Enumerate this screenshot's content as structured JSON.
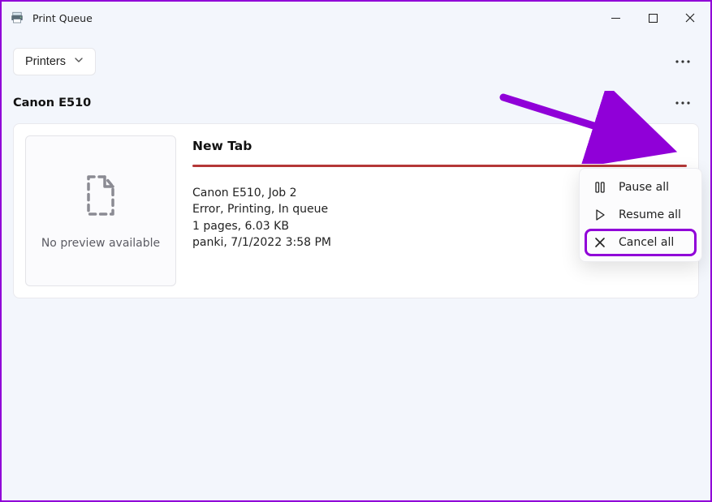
{
  "window": {
    "title": "Print Queue"
  },
  "toolbar": {
    "printers_label": "Printers"
  },
  "printer": {
    "name": "Canon E510"
  },
  "job": {
    "title": "New Tab",
    "preview_caption": "No preview available",
    "line1": "Canon E510, Job 2",
    "line2": "Error, Printing, In queue",
    "line3": "1 pages, 6.03 KB",
    "line4": "panki, 7/1/2022 3:58 PM"
  },
  "menu": {
    "pause": "Pause all",
    "resume": "Resume all",
    "cancel": "Cancel all"
  }
}
